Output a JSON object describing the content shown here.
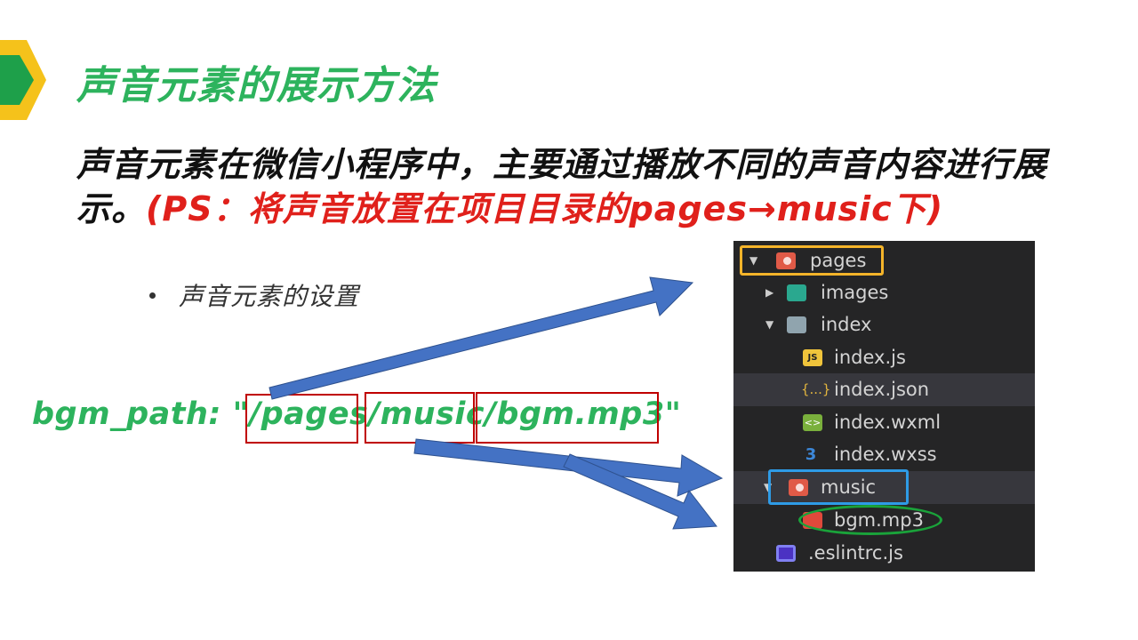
{
  "slide": {
    "title": "声音元素的展示方法",
    "description_main": "声音元素在微信小程序中，主要通过播放不同的声音内容进行展示。",
    "description_ps": "(PS：将声音放置在项目目录的pages→music下)",
    "bullet": "声音元素的设置",
    "code_path": "bgm_path: \"/pages/music/bgm.mp3\""
  },
  "file_tree": {
    "rows": [
      {
        "label": "pages",
        "twisty": "▼",
        "icon": "folder-red-icon"
      },
      {
        "label": "images",
        "twisty": "▶",
        "icon": "folder-images-icon"
      },
      {
        "label": "index",
        "twisty": "▼",
        "icon": "folder-open-icon"
      },
      {
        "label": "index.js",
        "twisty": "",
        "icon": "js-file-icon",
        "icon_text": "JS"
      },
      {
        "label": "index.json",
        "twisty": "",
        "icon": "json-file-icon",
        "icon_text": "{...}"
      },
      {
        "label": "index.wxml",
        "twisty": "",
        "icon": "wxml-file-icon",
        "icon_text": "<>"
      },
      {
        "label": "index.wxss",
        "twisty": "",
        "icon": "wxss-file-icon",
        "icon_text": "3"
      },
      {
        "label": "music",
        "twisty": "▼",
        "icon": "folder-music-icon"
      },
      {
        "label": "bgm.mp3",
        "twisty": "",
        "icon": "audio-file-icon"
      },
      {
        "label": ".eslintrc.js",
        "twisty": "",
        "icon": "eslint-file-icon"
      }
    ]
  },
  "colors": {
    "title_green": "#2db35d",
    "ps_red": "#e0201b",
    "arrow_blue": "#4472c4",
    "highlight_red": "#c00000",
    "tree_bg": "#252526",
    "pages_box": "#f4b42a",
    "music_box": "#2e9be6",
    "mp3_ellipse": "#1aa33a"
  }
}
